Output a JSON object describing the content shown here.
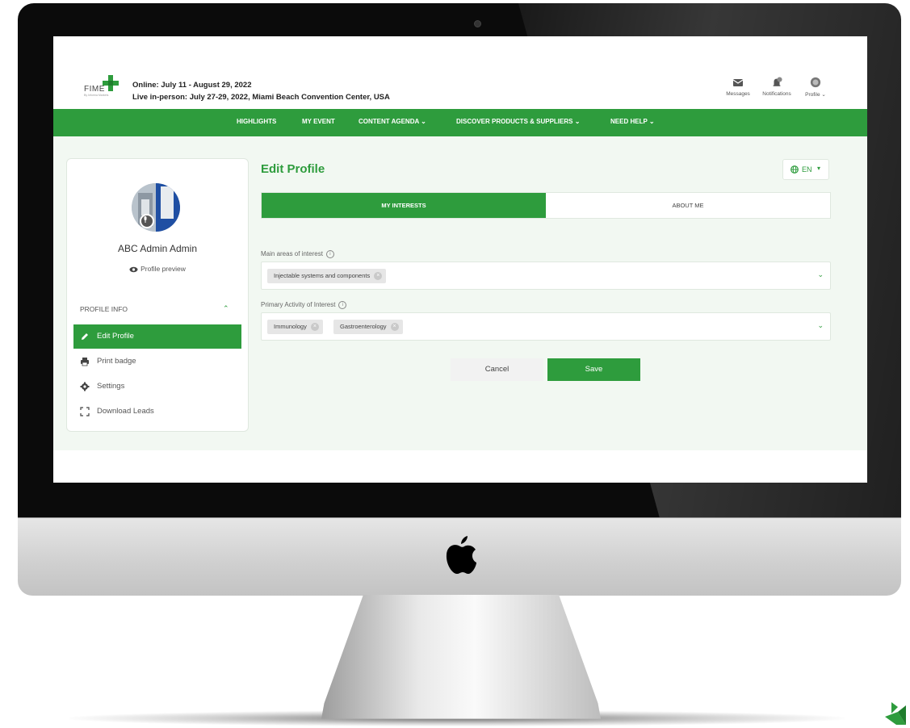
{
  "header": {
    "logo_text": "FIME",
    "logo_subtext": "By Informa Markets",
    "event_online": "Online: July 11 - August 29, 2022",
    "event_live": "Live in-person: July 27-29, 2022, Miami Beach Convention Center, USA",
    "messages_label": "Messages",
    "notifications_label": "Notifications",
    "profile_label": "Profile"
  },
  "nav": {
    "items": [
      {
        "label": "HIGHLIGHTS"
      },
      {
        "label": "MY EVENT"
      },
      {
        "label": "CONTENT AGENDA ⌄"
      },
      {
        "label": "DISCOVER PRODUCTS & SUPPLIERS ⌄"
      },
      {
        "label": "NEED HELP ⌄"
      }
    ]
  },
  "sidebar": {
    "user_name": "ABC Admin Admin",
    "profile_preview": "Profile preview",
    "section_title": "PROFILE INFO",
    "items": [
      {
        "label": "Edit Profile",
        "icon": "pencil-icon",
        "active": true
      },
      {
        "label": "Print badge",
        "icon": "printer-icon",
        "active": false
      },
      {
        "label": "Settings",
        "icon": "gear-icon",
        "active": false
      },
      {
        "label": "Download Leads",
        "icon": "expand-icon",
        "active": false
      }
    ]
  },
  "main": {
    "title": "Edit Profile",
    "language": "EN",
    "tabs": [
      {
        "label": "MY INTERESTS",
        "active": true
      },
      {
        "label": "ABOUT ME",
        "active": false
      }
    ],
    "fields": [
      {
        "label": "Main areas of interest",
        "chips": [
          "Injectable systems and components"
        ]
      },
      {
        "label": "Primary Activity of Interest",
        "chips": [
          "Immunology",
          "Gastroenterology"
        ]
      }
    ],
    "cancel_label": "Cancel",
    "save_label": "Save"
  },
  "colors": {
    "brand_green": "#2e9c3d",
    "page_bg": "#f2f8f2"
  }
}
